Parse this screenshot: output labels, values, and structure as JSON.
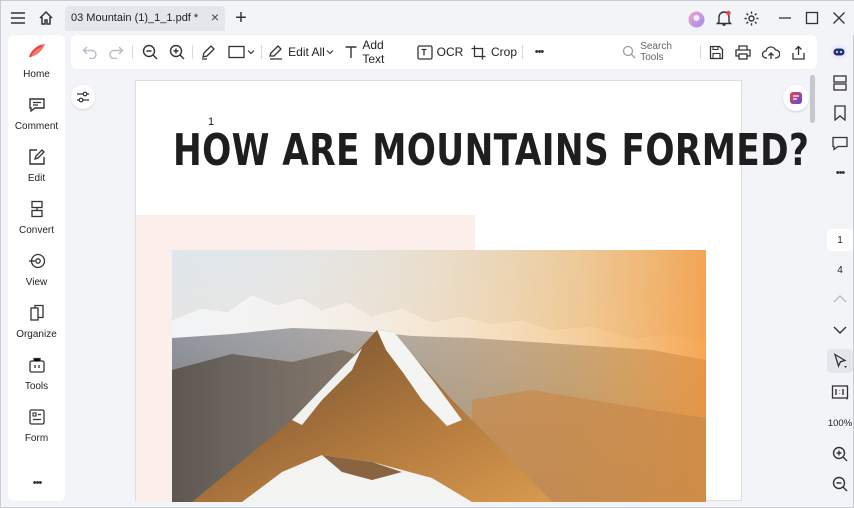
{
  "titlebar": {
    "tab_title": "03 Mountain (1)_1_1.pdf *",
    "tab_close": "×",
    "new_tab": "+"
  },
  "sidebar": {
    "items": [
      {
        "label": "Home",
        "icon": "home-brand-icon"
      },
      {
        "label": "Comment",
        "icon": "comment-icon"
      },
      {
        "label": "Edit",
        "icon": "edit-icon"
      },
      {
        "label": "Convert",
        "icon": "convert-icon"
      },
      {
        "label": "View",
        "icon": "view-icon"
      },
      {
        "label": "Organize",
        "icon": "organize-icon"
      },
      {
        "label": "Tools",
        "icon": "tools-icon"
      },
      {
        "label": "Form",
        "icon": "form-icon"
      }
    ],
    "more": "•••"
  },
  "toolbar": {
    "edit_all": "Edit All",
    "add_text": "Add Text",
    "ocr": "OCR",
    "crop": "Crop",
    "more": "•••",
    "search_placeholder": "Search Tools"
  },
  "document": {
    "page_label": "1",
    "heading": "HOW ARE MOUNTAINS FORMED?"
  },
  "rightbar": {
    "current_page": "1",
    "total_pages": "4",
    "zoom": "100%"
  },
  "colors": {
    "brand": "#e8434b",
    "accent": "#5b4bdb",
    "app_bg": "#f3f4f8",
    "panel_bg": "#ffffff",
    "blush_block": "#fbeeeb"
  }
}
